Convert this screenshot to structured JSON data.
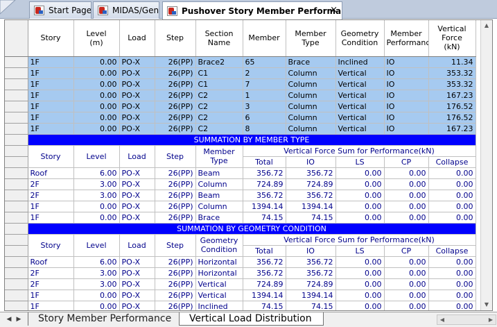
{
  "tabs": [
    {
      "label": "Start Page"
    },
    {
      "label": "MIDAS/Gen"
    },
    {
      "label": "Pushover Story Member Performance",
      "close": "×"
    }
  ],
  "main_headers": [
    "Story",
    "Level\n(m)",
    "Load",
    "Step",
    "Section\nName",
    "Member",
    "Member\nType",
    "Geometry\nCondition",
    "Member\nPerformance",
    "Vertical\nForce\n(kN)"
  ],
  "main_rows": [
    [
      "1F",
      "0.00",
      "PO-X",
      "26(PP)",
      "Brace2",
      "65",
      "Brace",
      "Inclined",
      "IO",
      "11.34"
    ],
    [
      "1F",
      "0.00",
      "PO-X",
      "26(PP)",
      "C1",
      "2",
      "Column",
      "Vertical",
      "IO",
      "353.32"
    ],
    [
      "1F",
      "0.00",
      "PO-X",
      "26(PP)",
      "C1",
      "7",
      "Column",
      "Vertical",
      "IO",
      "353.32"
    ],
    [
      "1F",
      "0.00",
      "PO-X",
      "26(PP)",
      "C2",
      "1",
      "Column",
      "Vertical",
      "IO",
      "167.23"
    ],
    [
      "1F",
      "0.00",
      "PO-X",
      "26(PP)",
      "C2",
      "3",
      "Column",
      "Vertical",
      "IO",
      "176.52"
    ],
    [
      "1F",
      "0.00",
      "PO-X",
      "26(PP)",
      "C2",
      "6",
      "Column",
      "Vertical",
      "IO",
      "176.52"
    ],
    [
      "1F",
      "0.00",
      "PO-X",
      "26(PP)",
      "C2",
      "8",
      "Column",
      "Vertical",
      "IO",
      "167.23"
    ]
  ],
  "sum_type": {
    "title": "SUMMATION BY MEMBER TYPE",
    "headers": [
      "Story",
      "Level",
      "Load",
      "Step",
      "Member\nType"
    ],
    "group_header": "Vertical Force Sum for Performance(kN)",
    "sub_headers": [
      "Total",
      "IO",
      "LS",
      "CP",
      "Collapse"
    ],
    "rows": [
      [
        "Roof",
        "6.00",
        "PO-X",
        "26(PP)",
        "Beam",
        "356.72",
        "356.72",
        "0.00",
        "0.00",
        "0.00"
      ],
      [
        "2F",
        "3.00",
        "PO-X",
        "26(PP)",
        "Column",
        "724.89",
        "724.89",
        "0.00",
        "0.00",
        "0.00"
      ],
      [
        "2F",
        "3.00",
        "PO-X",
        "26(PP)",
        "Beam",
        "356.72",
        "356.72",
        "0.00",
        "0.00",
        "0.00"
      ],
      [
        "1F",
        "0.00",
        "PO-X",
        "26(PP)",
        "Column",
        "1394.14",
        "1394.14",
        "0.00",
        "0.00",
        "0.00"
      ],
      [
        "1F",
        "0.00",
        "PO-X",
        "26(PP)",
        "Brace",
        "74.15",
        "74.15",
        "0.00",
        "0.00",
        "0.00"
      ]
    ]
  },
  "sum_geom": {
    "title": "SUMMATION BY GEOMETRY CONDITION",
    "headers": [
      "Story",
      "Level",
      "Load",
      "Step",
      "Geometry\nCondition"
    ],
    "group_header": "Vertical Force Sum for Performance(kN)",
    "sub_headers": [
      "Total",
      "IO",
      "LS",
      "CP",
      "Collapse"
    ],
    "rows": [
      [
        "Roof",
        "6.00",
        "PO-X",
        "26(PP)",
        "Horizontal",
        "356.72",
        "356.72",
        "0.00",
        "0.00",
        "0.00"
      ],
      [
        "2F",
        "3.00",
        "PO-X",
        "26(PP)",
        "Horizontal",
        "356.72",
        "356.72",
        "0.00",
        "0.00",
        "0.00"
      ],
      [
        "2F",
        "3.00",
        "PO-X",
        "26(PP)",
        "Vertical",
        "724.89",
        "724.89",
        "0.00",
        "0.00",
        "0.00"
      ],
      [
        "1F",
        "0.00",
        "PO-X",
        "26(PP)",
        "Vertical",
        "1394.14",
        "1394.14",
        "0.00",
        "0.00",
        "0.00"
      ],
      [
        "1F",
        "0.00",
        "PO-X",
        "26(PP)",
        "Inclined",
        "74.15",
        "74.15",
        "0.00",
        "0.00",
        "0.00"
      ]
    ]
  },
  "sheet_tabs": [
    "Story Member Performance",
    "Vertical Load Distribution"
  ],
  "active_sheet": 1
}
